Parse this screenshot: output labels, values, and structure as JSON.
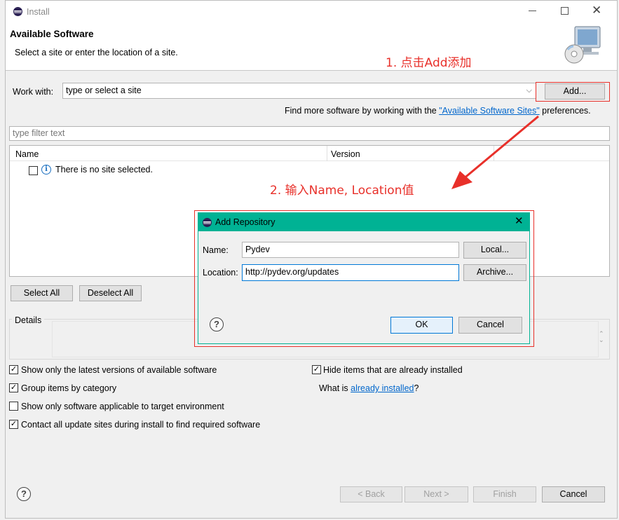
{
  "window": {
    "title": "Install",
    "banner_title": "Available Software",
    "banner_subtitle": "Select a site or enter the location of a site."
  },
  "work_with": {
    "label": "Work with:",
    "value": "type or select a site",
    "add_button": "Add...",
    "find_more_prefix": "Find more software by working with the ",
    "find_more_link": "\"Available Software Sites\"",
    "find_more_suffix": " preferences."
  },
  "filter": {
    "placeholder": "type filter text"
  },
  "table": {
    "columns": [
      "Name",
      "Version"
    ],
    "empty_message": "There is no site selected."
  },
  "selection_buttons": {
    "select_all": "Select All",
    "deselect_all": "Deselect All"
  },
  "details": {
    "label": "Details"
  },
  "options": {
    "left": [
      {
        "label": "Show only the latest versions of available software",
        "checked": true
      },
      {
        "label": "Group items by category",
        "checked": true
      },
      {
        "label": "Show only software applicable to target environment",
        "checked": false
      },
      {
        "label": "Contact all update sites during install to find required software",
        "checked": true
      }
    ],
    "hide_installed": {
      "label": "Hide items that are already installed",
      "checked": true
    },
    "what_is_prefix": "What is ",
    "what_is_link": "already installed",
    "what_is_suffix": "?"
  },
  "footer": {
    "back": "< Back",
    "next": "Next >",
    "finish": "Finish",
    "cancel": "Cancel"
  },
  "dialog": {
    "title": "Add Repository",
    "name_label": "Name:",
    "name_value": "Pydev",
    "location_label": "Location:",
    "location_value": "http://pydev.org/updates",
    "local_button": "Local...",
    "archive_button": "Archive...",
    "ok_button": "OK",
    "cancel_button": "Cancel",
    "titlebar_color": "#00b294"
  },
  "annotations": {
    "step1": "1. 点击Add添加",
    "step2": "2. 输入Name, Location值",
    "color": "#e8302a"
  },
  "icons": {
    "app": "eclipse-icon",
    "banner": "install-monitor-icon",
    "info": "info-icon",
    "help": "help-icon",
    "minimize": "minimize-icon",
    "maximize": "maximize-icon",
    "close": "close-icon",
    "dropdown": "chevron-down-icon"
  }
}
